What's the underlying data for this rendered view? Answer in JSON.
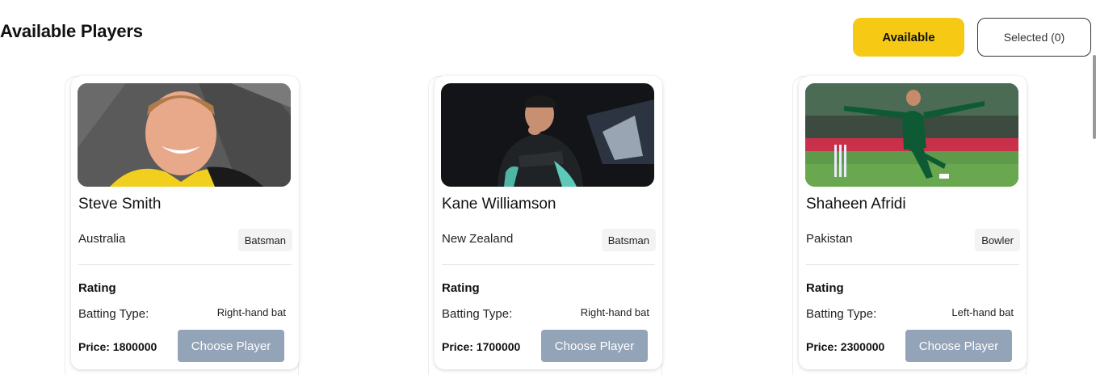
{
  "header": {
    "title": "Available Players",
    "available_label": "Available",
    "selected_label": "Selected (0)"
  },
  "players": [
    {
      "name": "Steve Smith",
      "country": "Australia",
      "role": "Batsman",
      "rating_label": "Rating",
      "batting_type_label": "Batting Type:",
      "batting_type": "Right-hand bat",
      "price": "Price: 1800000",
      "choose_label": "Choose Player"
    },
    {
      "name": "Kane Williamson",
      "country": "New Zealand",
      "role": "Batsman",
      "rating_label": "Rating",
      "batting_type_label": "Batting Type:",
      "batting_type": "Right-hand bat",
      "price": "Price: 1700000",
      "choose_label": "Choose Player"
    },
    {
      "name": "Shaheen Afridi",
      "country": "Pakistan",
      "role": "Bowler",
      "rating_label": "Rating",
      "batting_type_label": "Batting Type:",
      "batting_type": "Left-hand bat",
      "price": "Price: 2300000",
      "choose_label": "Choose Player"
    }
  ],
  "colors": {
    "accent": "#f6c915",
    "button_disabled": "#93a3b8"
  }
}
